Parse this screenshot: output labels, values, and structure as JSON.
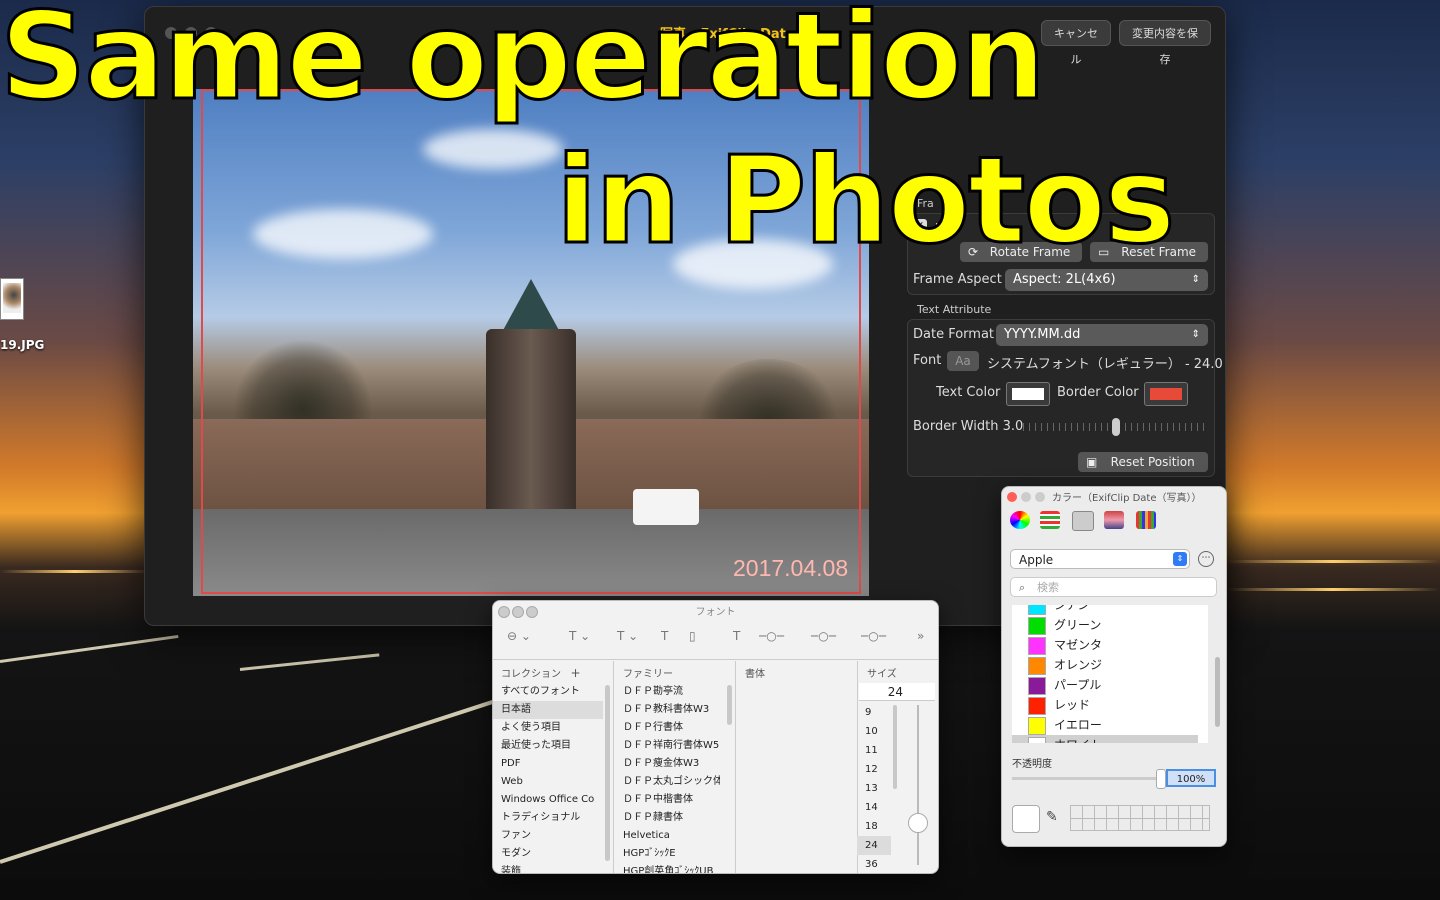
{
  "overlay": {
    "line1": "Same operation",
    "line2": "in Photos"
  },
  "desktop": {
    "file_label": "19.JPG"
  },
  "main_window": {
    "title": "写真 - ExifClip Date",
    "cancel": "キャンセル",
    "save": "変更内容を保存",
    "date_stamp": "2017.04.08",
    "frame_group": "Fra",
    "frame_checkbox": "me?",
    "rotate_frame": "Rotate Frame",
    "reset_frame": "Reset Frame",
    "frame_aspect_label": "Frame Aspect",
    "frame_aspect_value": "Aspect: 2L(4x6)",
    "text_attr_group": "Text Attribute",
    "date_format_label": "Date Format",
    "date_format_value": "YYYY.MM.dd",
    "font_label": "Font",
    "font_button": "Aa",
    "font_value": "システムフォント（レギュラー） - 24.0",
    "text_color_label": "Text Color",
    "border_color_label": "Border Color",
    "border_width_label": "Border Width 3.0",
    "border_width_value": 0.5,
    "reset_position": "Reset Position",
    "colors": {
      "text": "#ffffff",
      "border": "#e84a3a",
      "frame": "#e04a4a",
      "title": "#f2c21a"
    }
  },
  "font_panel": {
    "title": "フォント",
    "headers": {
      "collection": "コレクション",
      "family": "ファミリー",
      "typeface": "書体",
      "size": "サイズ"
    },
    "collections": [
      "すべてのフォント",
      "日本語",
      "よく使う項目",
      "最近使った項目",
      "PDF",
      "Web",
      "Windows Office Co",
      "トラディショナル",
      "ファン",
      "モダン",
      "装飾"
    ],
    "families": [
      "ＤＦＰ勘亭流",
      "ＤＦＰ教科書体W3",
      "ＤＦＰ行書体",
      "ＤＦＰ祥南行書体W5",
      "ＤＦＰ痩金体W3",
      "ＤＦＰ太丸ゴシック体",
      "ＤＦＰ中楷書体",
      "ＤＦＰ隷書体",
      "Helvetica",
      "HGPｺﾞｼｯｸE",
      "HGP創英角ｺﾞｼｯｸUB"
    ],
    "size_field": "24",
    "sizes": [
      "9",
      "10",
      "11",
      "12",
      "13",
      "14",
      "18",
      "24",
      "36"
    ]
  },
  "color_panel": {
    "title": "カラー（ExifClip Date（写真））",
    "palette": "Apple",
    "search_placeholder": "検索",
    "colors": [
      {
        "name": "シアン",
        "hex": "#00e5ff"
      },
      {
        "name": "グリーン",
        "hex": "#00dd00"
      },
      {
        "name": "マゼンタ",
        "hex": "#ff33ff"
      },
      {
        "name": "オレンジ",
        "hex": "#ff8800"
      },
      {
        "name": "パープル",
        "hex": "#8a1a9a"
      },
      {
        "name": "レッド",
        "hex": "#ff2200"
      },
      {
        "name": "イエロー",
        "hex": "#ffff00"
      },
      {
        "name": "ホワイト",
        "hex": "#ffffff"
      }
    ],
    "opacity_label": "不透明度",
    "opacity_value": "100%"
  }
}
